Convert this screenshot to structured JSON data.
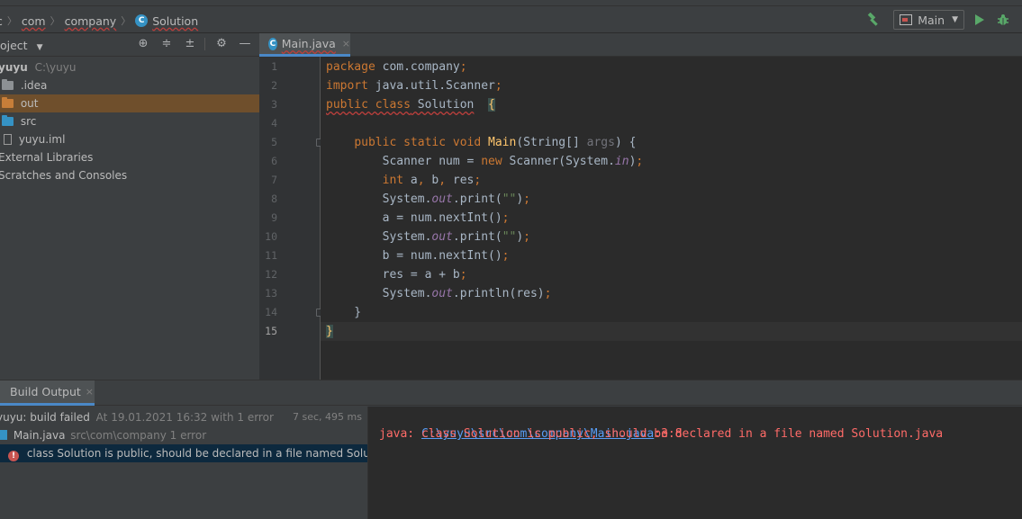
{
  "breadcrumb": {
    "items": [
      "c",
      "com",
      "company",
      "Solution"
    ],
    "class_icon_letter": "C"
  },
  "toolbar": {
    "run_config_label": "Main"
  },
  "project_panel": {
    "title": "oject",
    "tree": [
      {
        "label": "yuyu",
        "path": "C:\\yuyu",
        "kind": "module"
      },
      {
        "label": ".idea",
        "kind": "folder",
        "color": "#8d9194"
      },
      {
        "label": "out",
        "kind": "folder",
        "color": "#c77e39"
      },
      {
        "label": "src",
        "kind": "folder",
        "color": "#3592c4"
      },
      {
        "label": "yuyu.iml",
        "kind": "file"
      },
      {
        "label": "External Libraries",
        "kind": "group"
      },
      {
        "label": "Scratches and Consoles",
        "kind": "group"
      }
    ]
  },
  "editor": {
    "tab_label": "Main.java",
    "tab_close": "×",
    "line_numbers": [
      "1",
      "2",
      "3",
      "4",
      "5",
      "6",
      "7",
      "8",
      "9",
      "10",
      "11",
      "12",
      "13",
      "14",
      "15"
    ],
    "current_line": 15
  },
  "build": {
    "tab_label": "Build Output",
    "tab_close": "×",
    "tree": {
      "root_name": "yuyu: build failed",
      "root_detail": "At 19.01.2021 16:32 with 1 error",
      "root_time": "7 sec, 495 ms",
      "file_name": "Main.java",
      "file_detail": "src\\com\\company 1 error",
      "error_message": "class Solution is public, should be declared in a file named Solution.java"
    },
    "output": {
      "link": "C:\\yuyu\\src\\com\\company\\Main.java",
      "location": ":3:8",
      "message": "java: class Solution is public, should be declared in a file named Solution.java"
    }
  },
  "colors": {
    "keyword": "#cc7832",
    "method": "#ffc66d",
    "field_italic": "#9876aa",
    "string": "#6a8759",
    "error": "#ff6b68",
    "link": "#589df6",
    "accent": "#4a88c7"
  }
}
